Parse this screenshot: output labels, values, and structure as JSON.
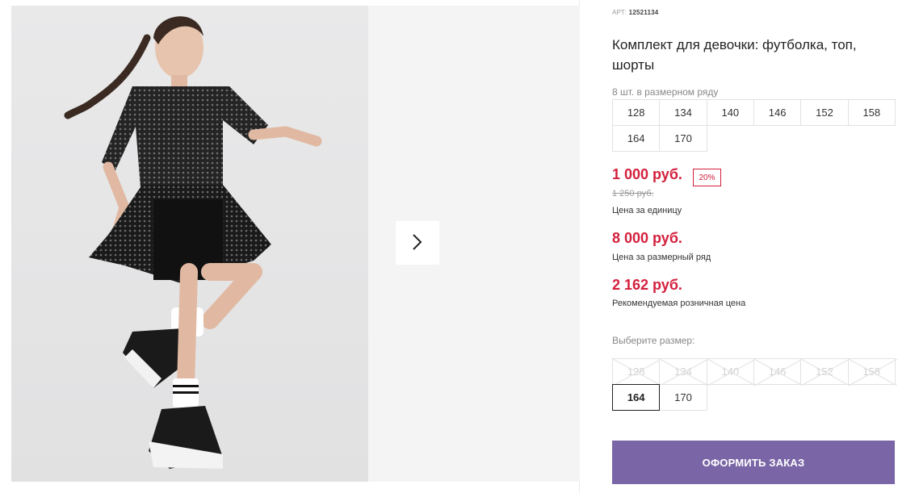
{
  "product": {
    "sku_label": "АРТ:",
    "sku_value": "12521134",
    "title": "Комплект для девочки: футболка, топ, шорты",
    "range_note": "8 шт. в размерном ряду"
  },
  "size_range": [
    "128",
    "134",
    "140",
    "146",
    "152",
    "158",
    "164",
    "170"
  ],
  "pricing": {
    "unit_price": "1 000 руб.",
    "discount_badge": "20%",
    "old_price": "1 250 руб.",
    "unit_caption": "Цена за единицу",
    "range_price": "8 000 руб.",
    "range_caption": "Цена за размерный ряд",
    "retail_price": "2 162 руб.",
    "retail_caption": "Рекомендуемая розничная цена"
  },
  "size_picker": {
    "label": "Выберите размер:",
    "options": [
      {
        "label": "128",
        "state": "unavailable"
      },
      {
        "label": "134",
        "state": "unavailable"
      },
      {
        "label": "140",
        "state": "unavailable"
      },
      {
        "label": "146",
        "state": "unavailable"
      },
      {
        "label": "152",
        "state": "unavailable"
      },
      {
        "label": "158",
        "state": "unavailable"
      },
      {
        "label": "164",
        "state": "selected"
      },
      {
        "label": "170",
        "state": "available"
      }
    ]
  },
  "actions": {
    "order_button": "ОФОРМИТЬ ЗАКАЗ"
  },
  "gallery": {
    "next_icon": "chevron-right-icon"
  },
  "colors": {
    "price_red": "#d31f3c",
    "order_button_bg": "#7a66a6"
  }
}
